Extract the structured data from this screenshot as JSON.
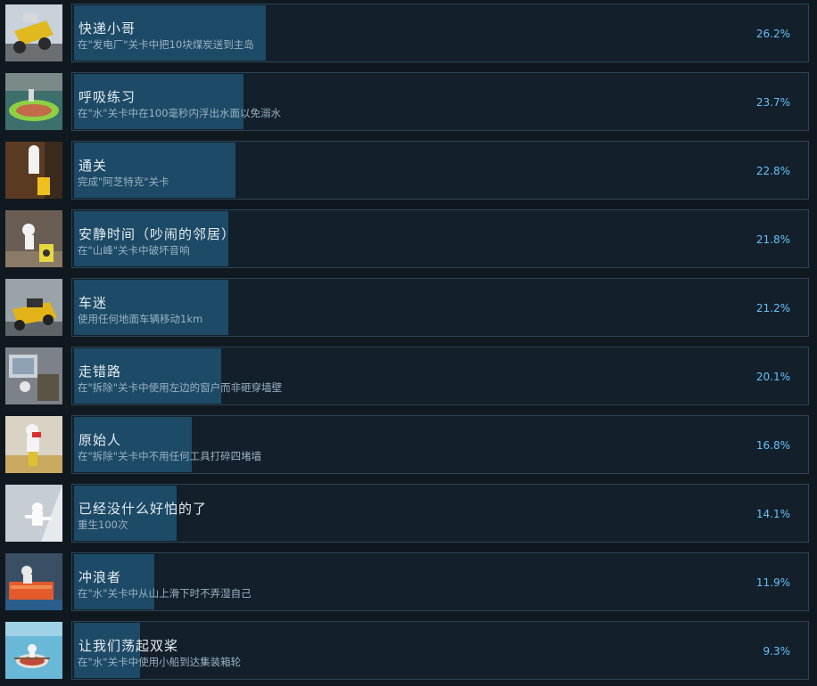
{
  "achievements": [
    {
      "title": "快递小哥",
      "desc": "在\"发电厂\"关卡中把10块煤炭送到主岛",
      "percent": "26.2%",
      "percent_value": 26.2,
      "icon": "truck-coal-icon"
    },
    {
      "title": "呼吸练习",
      "desc": "在\"水\"关卡中在100毫秒内浮出水面以免溺水",
      "percent": "23.7%",
      "percent_value": 23.7,
      "icon": "boat-breath-icon"
    },
    {
      "title": "通关",
      "desc": "完成\"阿芝特克\"关卡",
      "percent": "22.8%",
      "percent_value": 22.8,
      "icon": "aztec-character-icon"
    },
    {
      "title": "安静时间（吵闹的邻居）",
      "desc": "在\"山峰\"关卡中破坏音响",
      "percent": "21.8%",
      "percent_value": 21.8,
      "icon": "speaker-icon"
    },
    {
      "title": "车迷",
      "desc": "使用任何地面车辆移动1km",
      "percent": "21.2%",
      "percent_value": 21.2,
      "icon": "car-icon"
    },
    {
      "title": "走错路",
      "desc": "在\"拆除\"关卡中使用左边的窗户而非砸穿墙壁",
      "percent": "20.1%",
      "percent_value": 20.1,
      "icon": "window-icon"
    },
    {
      "title": "原始人",
      "desc": "在\"拆除\"关卡中不用任何工具打碎四堵墙",
      "percent": "16.8%",
      "percent_value": 16.8,
      "icon": "caveman-icon"
    },
    {
      "title": "已经没什么好怕的了",
      "desc": "重生100次",
      "percent": "14.1%",
      "percent_value": 14.1,
      "icon": "falling-character-icon"
    },
    {
      "title": "冲浪者",
      "desc": "在\"水\"关卡中从山上滑下时不弄湿自己",
      "percent": "11.9%",
      "percent_value": 11.9,
      "icon": "surf-mattress-icon"
    },
    {
      "title": "让我们荡起双桨",
      "desc": "在\"水\"关卡中使用小船到达集装箱轮",
      "percent": "9.3%",
      "percent_value": 9.3,
      "icon": "rowboat-icon"
    }
  ]
}
